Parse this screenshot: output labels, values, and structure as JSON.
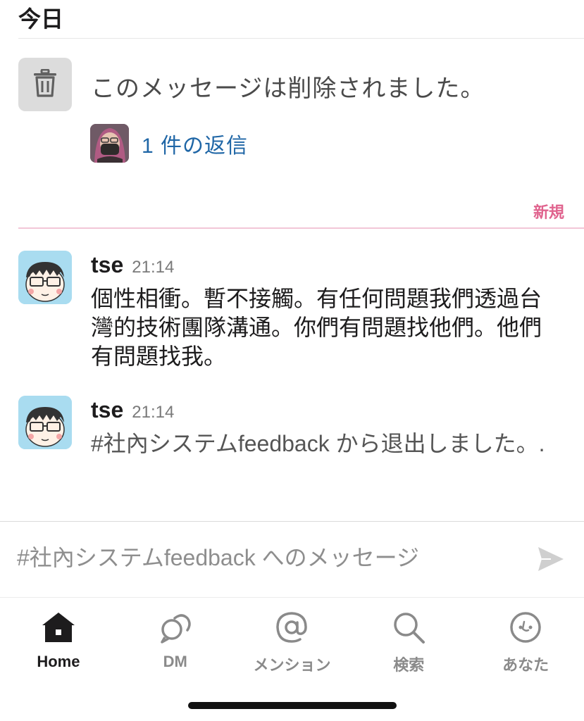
{
  "day_header": "今日",
  "deleted_message": {
    "text": "このメッセージは削除されました。",
    "icon": "trash-icon",
    "reply_link": "1 件の返信"
  },
  "new_divider": "新規",
  "messages": [
    {
      "name": "tse",
      "time": "21:14",
      "body": "個性相衝。暫不接觸。有任何問題我們透過台灣的技術團隊溝通。你們有問題找他們。他們有問題找我。"
    },
    {
      "name": "tse",
      "time": "21:14",
      "body": "#社內システムfeedback から退出しました。."
    }
  ],
  "composer": {
    "placeholder": "#社內システムfeedback へのメッセージ",
    "send_icon": "send-icon"
  },
  "tabs": [
    {
      "label": "Home",
      "icon": "home-icon",
      "active": true
    },
    {
      "label": "DM",
      "icon": "dm-icon",
      "active": false
    },
    {
      "label": "メンション",
      "icon": "at-icon",
      "active": false
    },
    {
      "label": "検索",
      "icon": "search-icon",
      "active": false
    },
    {
      "label": "あなた",
      "icon": "you-icon",
      "active": false
    }
  ],
  "colors": {
    "link": "#1f66a6",
    "new_divider": "#e0638e",
    "avatar_bg": "#a9dcf0"
  }
}
